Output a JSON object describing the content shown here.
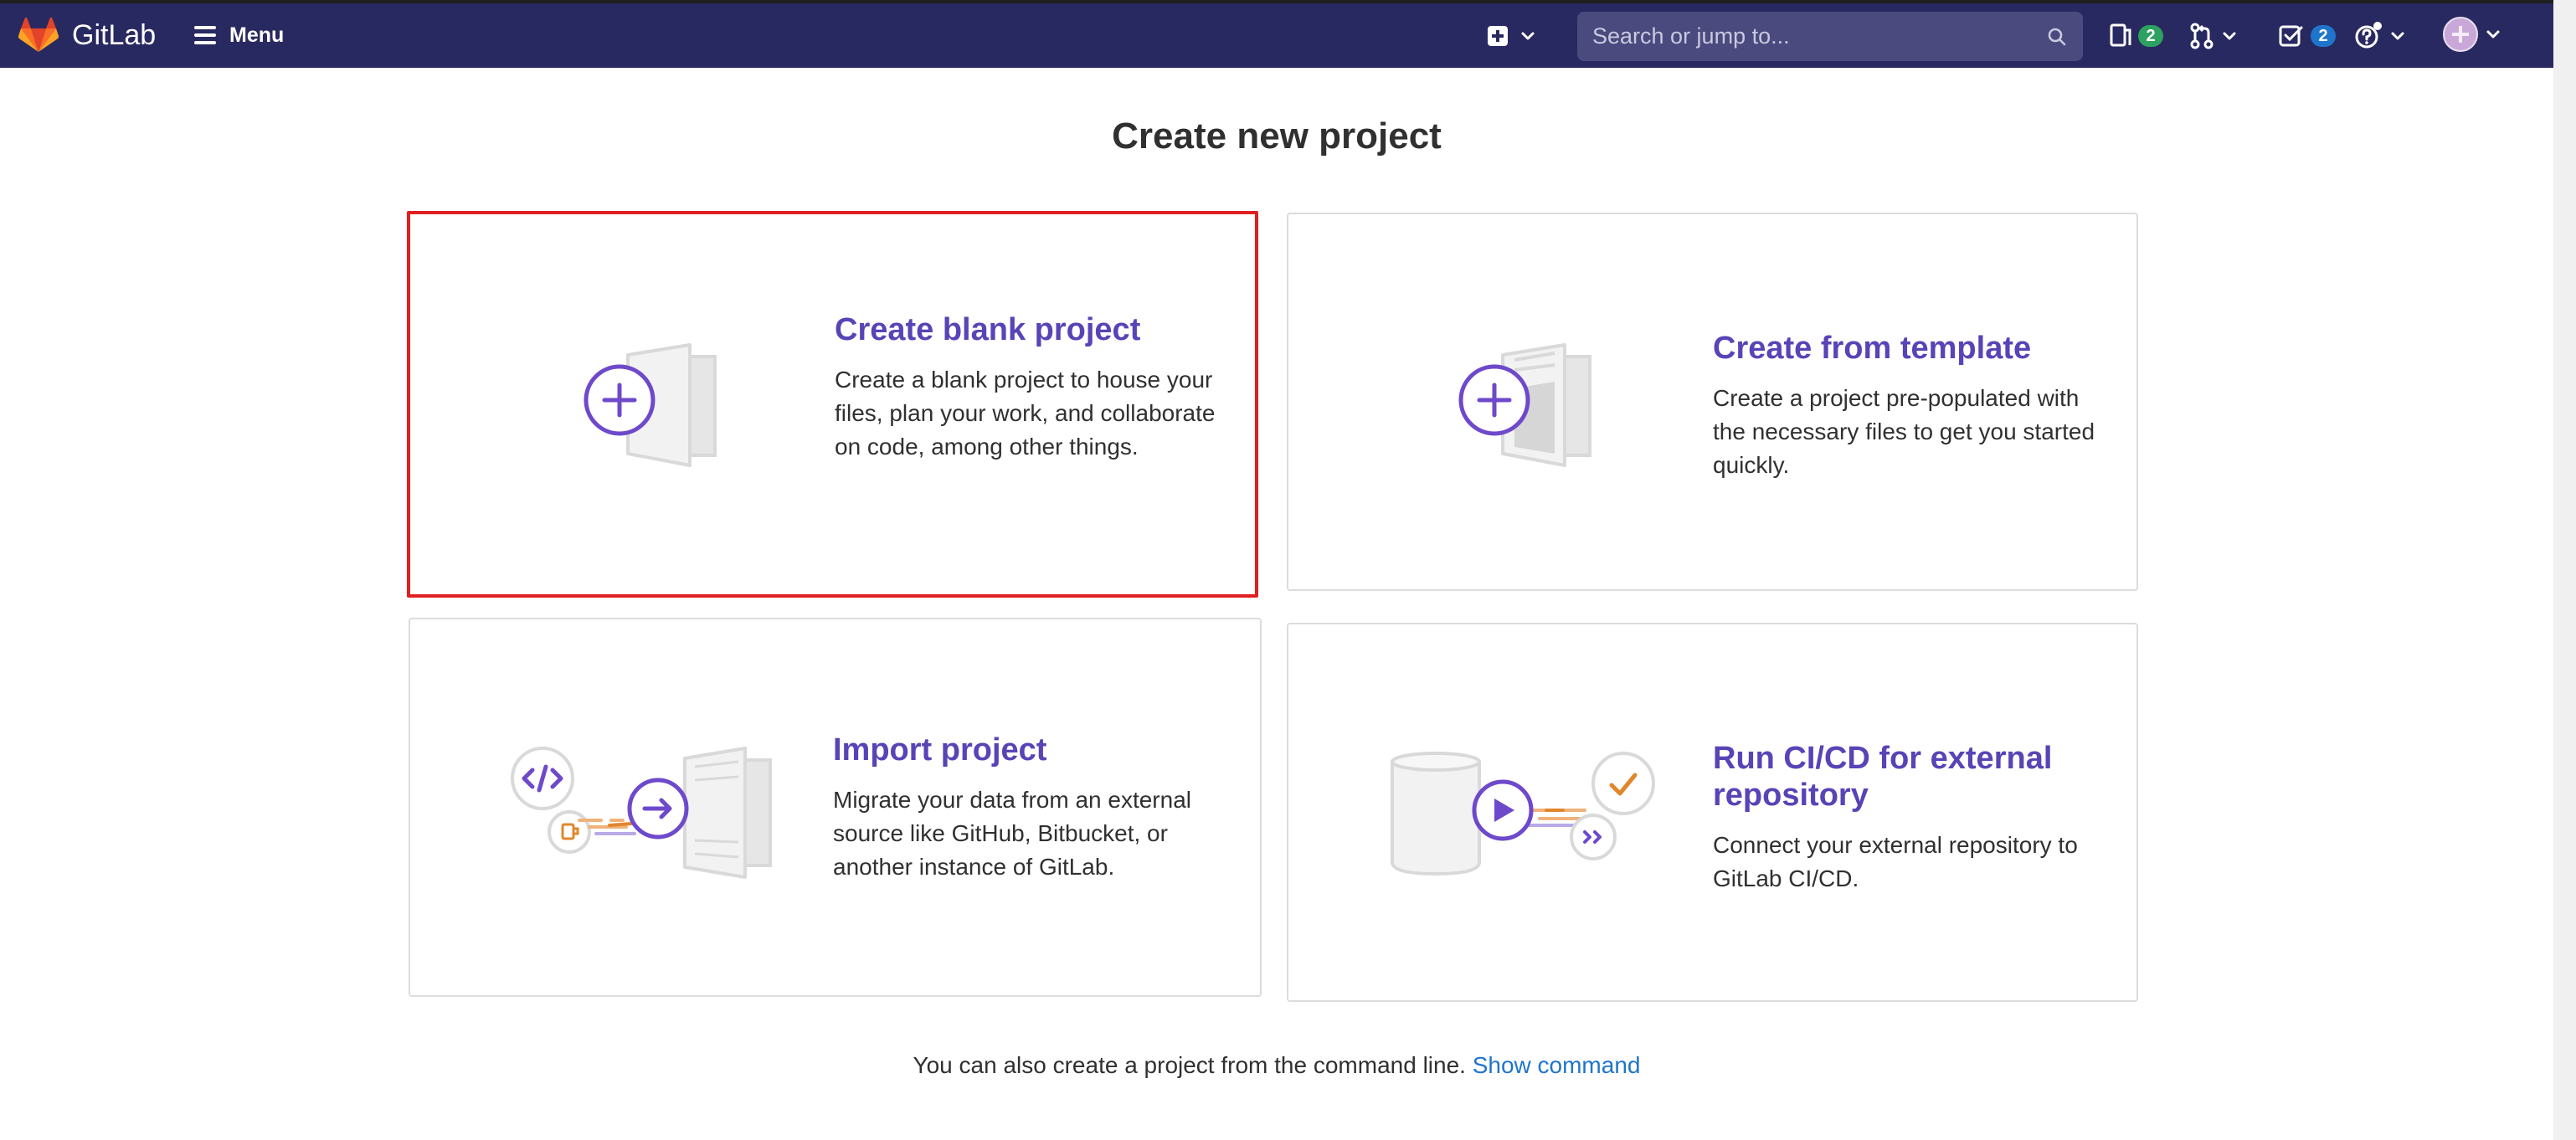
{
  "app": {
    "brand": "GitLab",
    "menu_label": "Menu"
  },
  "navbar": {
    "search_placeholder": "Search or jump to...",
    "issues_count": "2",
    "todos_count": "2",
    "icons": {
      "logo": "gitlab-tanuki-logo",
      "menu": "hamburger-icon",
      "new": "plus-square-icon",
      "search": "search-icon",
      "issues": "issues-icon",
      "merge_requests": "merge-request-icon",
      "todos": "todo-icon",
      "help": "help-icon",
      "avatar": "user-avatar"
    },
    "colors": {
      "bar": "#292961",
      "issues_badge": "#2da160",
      "todos_badge": "#1f75cb"
    }
  },
  "page": {
    "title": "Create new project",
    "cards": [
      {
        "id": "blank",
        "title": "Create blank project",
        "description": "Create a blank project to house your files, plan your work, and collaborate on code, among other things.",
        "selected": true
      },
      {
        "id": "template",
        "title": "Create from template",
        "description": "Create a project pre-populated with the necessary files to get you started quickly."
      },
      {
        "id": "import",
        "title": "Import project",
        "description": "Migrate your data from an external source like GitHub, Bitbucket, or another instance of GitLab."
      },
      {
        "id": "cicd",
        "title": "Run CI/CD for external repository",
        "description": "Connect your external repository to GitLab CI/CD."
      }
    ],
    "footer": {
      "text": "You can also create a project from the command line.",
      "link": "Show command"
    }
  },
  "colors": {
    "accent_purple": "#5943b6",
    "link_blue": "#1f75cb",
    "selection_red": "#e02020",
    "illustration_orange": "#e2862c"
  }
}
